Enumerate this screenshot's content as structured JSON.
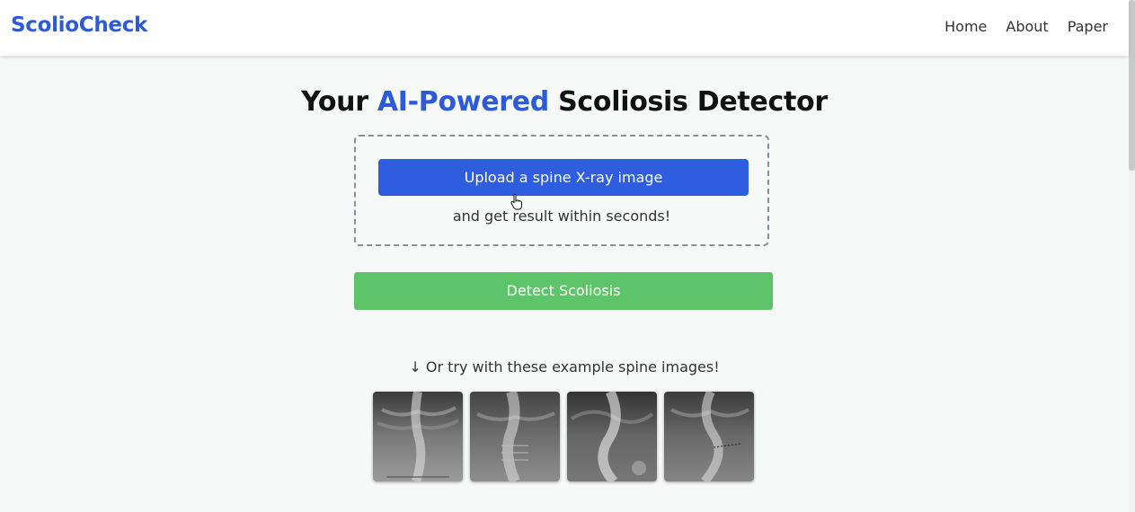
{
  "navbar": {
    "brand": "ScolioCheck",
    "links": [
      "Home",
      "About",
      "Paper"
    ]
  },
  "hero": {
    "title_prefix": "Your ",
    "title_accent": "AI-Powered",
    "title_suffix": " Scoliosis Detector"
  },
  "upload": {
    "button_label": "Upload a spine X-ray image",
    "subtitle": "and get result within seconds!"
  },
  "detect": {
    "button_label": "Detect Scoliosis"
  },
  "examples": {
    "label": "↓ Or try with these example spine images!",
    "images": [
      {
        "name": "example-xray-1"
      },
      {
        "name": "example-xray-2"
      },
      {
        "name": "example-xray-3"
      },
      {
        "name": "example-xray-4"
      }
    ]
  },
  "colors": {
    "brand": "#2d5bd8",
    "upload_button": "#2f5de0",
    "detect_button": "#5ec46a"
  }
}
